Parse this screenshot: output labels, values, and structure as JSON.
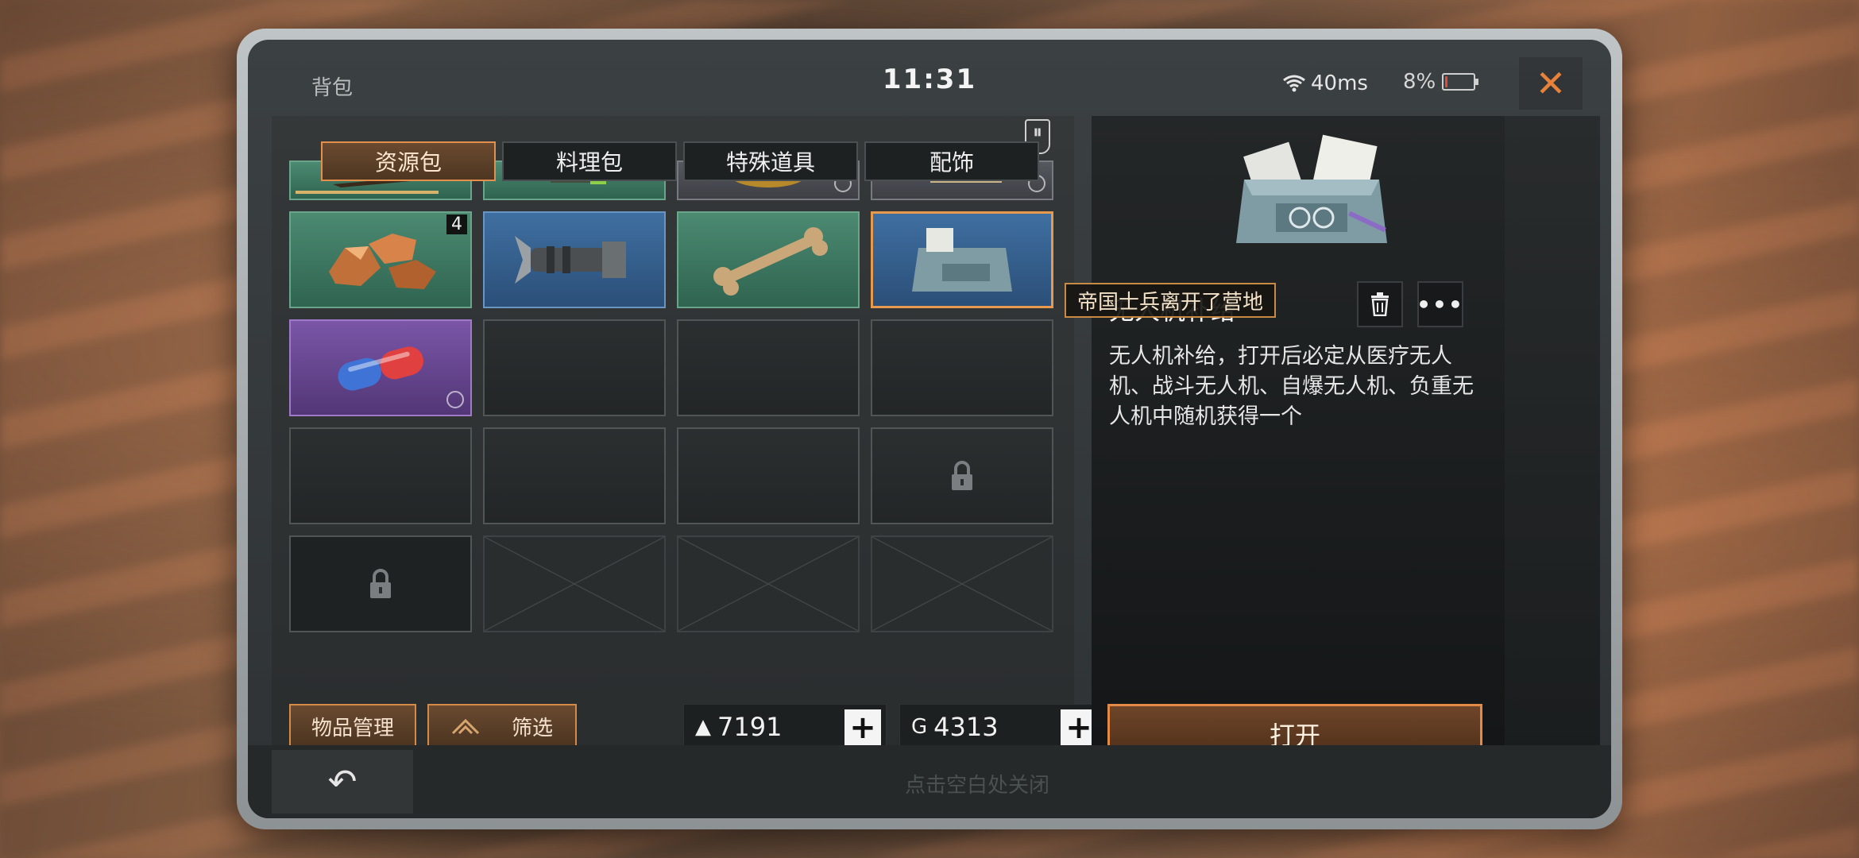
{
  "status": {
    "title": "背包",
    "time": "11:31",
    "ping": "40ms",
    "battery": "8%",
    "battery_level": 0.08,
    "close_glyph": "✕"
  },
  "tabs": [
    {
      "label": "资源包",
      "active": true
    },
    {
      "label": "料理包",
      "active": false
    },
    {
      "label": "特殊道具",
      "active": false
    },
    {
      "label": "配饰",
      "active": false
    }
  ],
  "grid": {
    "rows": [
      [
        {
          "rarity": "green",
          "item": "knife"
        },
        {
          "rarity": "green",
          "item": "tool"
        },
        {
          "rarity": "gray",
          "item": "pot"
        },
        {
          "rarity": "gray",
          "item": "scroll"
        }
      ],
      [
        {
          "rarity": "green",
          "item": "ore",
          "count": "4"
        },
        {
          "rarity": "blue",
          "item": "mechanical-part"
        },
        {
          "rarity": "green",
          "item": "bone"
        },
        {
          "rarity": "blue",
          "item": "drone-supply",
          "selected": true
        }
      ],
      [
        {
          "rarity": "purple",
          "item": "capsule"
        },
        {
          "state": "empty"
        },
        {
          "state": "empty"
        },
        {
          "state": "empty"
        }
      ],
      [
        {
          "state": "empty"
        },
        {
          "state": "empty"
        },
        {
          "state": "empty"
        },
        {
          "state": "locked"
        }
      ],
      [
        {
          "state": "locked"
        },
        {
          "state": "unavailable"
        },
        {
          "state": "unavailable"
        },
        {
          "state": "unavailable"
        }
      ]
    ]
  },
  "tooltip": "帝国士兵离开了营地",
  "controls": {
    "manage_label": "物品管理",
    "filter_label": "筛选",
    "currency_a": "7191",
    "currency_b": "4313",
    "currency_b_icon": "G"
  },
  "detail": {
    "name": "无人机补给",
    "description": "无人机补给，打开后必定从医疗无人机、战斗无人机、自爆无人机、负重无人机中随机获得一个",
    "open_label": "打开",
    "more_glyph": "•••"
  },
  "footer": {
    "hint": "点击空白处关闭",
    "back_glyph": "↶"
  },
  "colors": {
    "accent": "#e38a46",
    "green_rarity": "#4c8a72",
    "blue_rarity": "#3f6fa1",
    "purple_rarity": "#7b56a8"
  }
}
